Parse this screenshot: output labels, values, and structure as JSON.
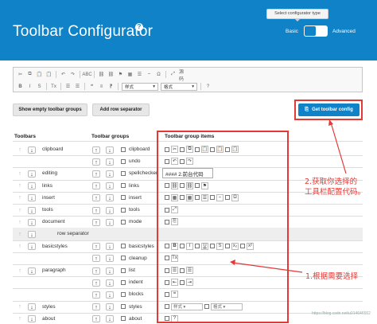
{
  "header": {
    "title": "Toolbar Configurator",
    "help_glyph": "?",
    "tooltip": "Select configurator type",
    "basic_label": "Basic",
    "advanced_label": "Advanced",
    "bg_color": "#0f82c8"
  },
  "editor_toolbar": {
    "row1": [
      "✂",
      "⧉",
      "📋",
      "📋",
      "↶",
      "↷",
      "ABC",
      "⛓",
      "⛓",
      "⚑",
      "▦",
      "☰",
      "⎯",
      "Ω",
      "⤢",
      "源码"
    ],
    "row2": [
      "B",
      "I",
      "S",
      "Tx",
      "☰",
      "☰",
      "❝",
      "≡",
      "⁋"
    ],
    "style_dropdown": "样式",
    "format_dropdown": "格式",
    "help": "?"
  },
  "buttons": {
    "show_empty": "Show empty toolbar groups",
    "add_separator": "Add row separator",
    "get_config": "Get toolbar config",
    "get_config_icon": "⎘"
  },
  "columns": {
    "toolbars": "Toolbars",
    "groups": "Toolbar groups",
    "items": "Toolbar group items"
  },
  "rows": [
    {
      "toolbar": "clipboard",
      "group": "clipboard",
      "icons": [
        "✂",
        "⧉",
        "📋",
        "📋",
        "📋"
      ]
    },
    {
      "toolbar": "",
      "group": "undo",
      "icons": [
        "↶",
        "↷"
      ]
    },
    {
      "toolbar": "editing",
      "group": "spellchecker",
      "icons": []
    },
    {
      "toolbar": "links",
      "group": "links",
      "icons": [
        "⛓",
        "⛓",
        "⚑"
      ]
    },
    {
      "toolbar": "insert",
      "group": "insert",
      "icons": [
        "▦",
        "▦",
        "☰",
        "⎯",
        "Ω"
      ]
    },
    {
      "toolbar": "tools",
      "group": "tools",
      "icons": [
        "⤢"
      ]
    },
    {
      "toolbar": "document",
      "group": "mode",
      "icons": [
        "⎘"
      ]
    },
    {
      "toolbar": "row separator",
      "group": "",
      "icons": []
    },
    {
      "toolbar": "basicstyles",
      "group": "basicstyles",
      "icons": [
        "B",
        "I",
        "U",
        "S",
        "x₂",
        "x²"
      ]
    },
    {
      "toolbar": "",
      "group": "cleanup",
      "icons": [
        "Tx"
      ]
    },
    {
      "toolbar": "paragraph",
      "group": "list",
      "icons": [
        "☰",
        "☰"
      ]
    },
    {
      "toolbar": "",
      "group": "indent",
      "icons": [
        "⇤",
        "⇥"
      ]
    },
    {
      "toolbar": "",
      "group": "blocks",
      "icons": [
        "❝"
      ]
    },
    {
      "toolbar": "styles",
      "group": "styles",
      "icons": [
        "样式",
        "格式"
      ]
    },
    {
      "toolbar": "about",
      "group": "about",
      "icons": [
        "?"
      ]
    }
  ],
  "tooltip_text": "#### 2.前台代码",
  "annotations": {
    "get_config": "2.获取你选择的\n工具栏配置代码。",
    "choose": "1.根据需要选择"
  },
  "watermark": "https://blog.csdn.net/u014646662"
}
